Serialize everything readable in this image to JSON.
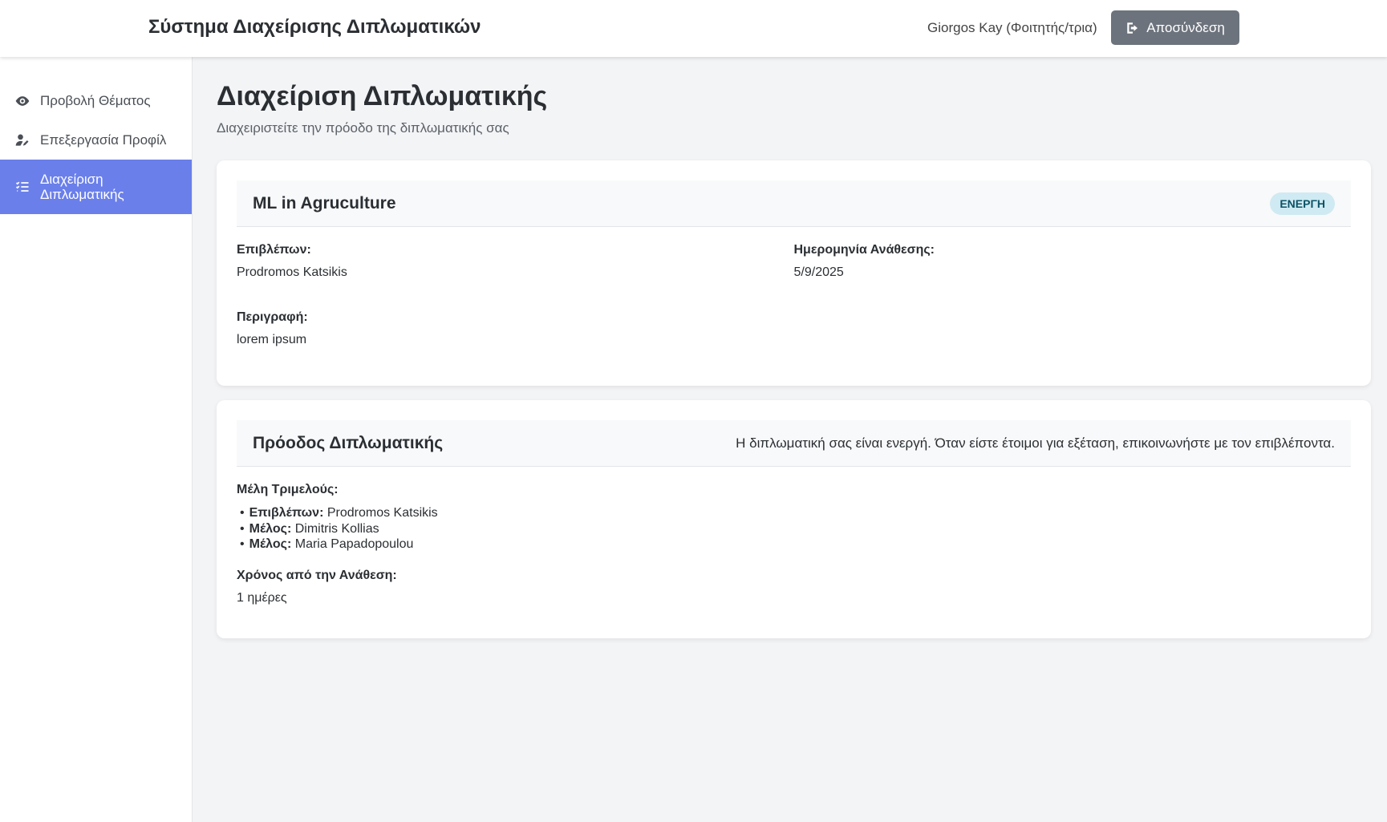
{
  "header": {
    "app_title": "Σύστημα Διαχείρισης Διπλωματικών",
    "user": "Giorgos Kay (Φοιτητής/τρια)",
    "logout_label": "Αποσύνδεση"
  },
  "sidebar": {
    "items": [
      {
        "label": "Προβολή Θέματος",
        "icon": "eye-icon",
        "active": false
      },
      {
        "label": "Επεξεργασία Προφίλ",
        "icon": "user-edit-icon",
        "active": false
      },
      {
        "label": "Διαχείριση Διπλωματικής",
        "icon": "task-list-icon",
        "active": true
      }
    ]
  },
  "page": {
    "title": "Διαχείριση Διπλωματικής",
    "subtitle": "Διαχειριστείτε την πρόοδο της διπλωματικής σας"
  },
  "thesis": {
    "title": "ML in Agruculture",
    "status": "ΕΝΕΡΓΗ",
    "supervisor_label": "Επιβλέπων:",
    "supervisor": "Prodromos Katsikis",
    "date_label": "Ημερομηνία Ανάθεσης:",
    "date": "5/9/2025",
    "description_label": "Περιγραφή:",
    "description": "lorem ipsum"
  },
  "progress": {
    "title": "Πρόοδος Διπλωματικής",
    "note": "Η διπλωματική σας είναι ενεργή. Όταν είστε έτοιμοι για εξέταση, επικοινωνήστε με τον επιβλέποντα.",
    "members_label": "Μέλη Τριμελούς:",
    "members": [
      {
        "role": "Επιβλέπων:",
        "name": "Prodromos Katsikis"
      },
      {
        "role": "Μέλος:",
        "name": "Dimitris Kollias"
      },
      {
        "role": "Μέλος:",
        "name": "Maria Papadopoulou"
      }
    ],
    "elapsed_label": "Χρόνος από την Ανάθεση:",
    "elapsed_value": "1 ημέρες"
  },
  "colors": {
    "accent": "#6a7fea",
    "logout_button": "#6c737c",
    "badge_bg": "#cfeaf2"
  }
}
